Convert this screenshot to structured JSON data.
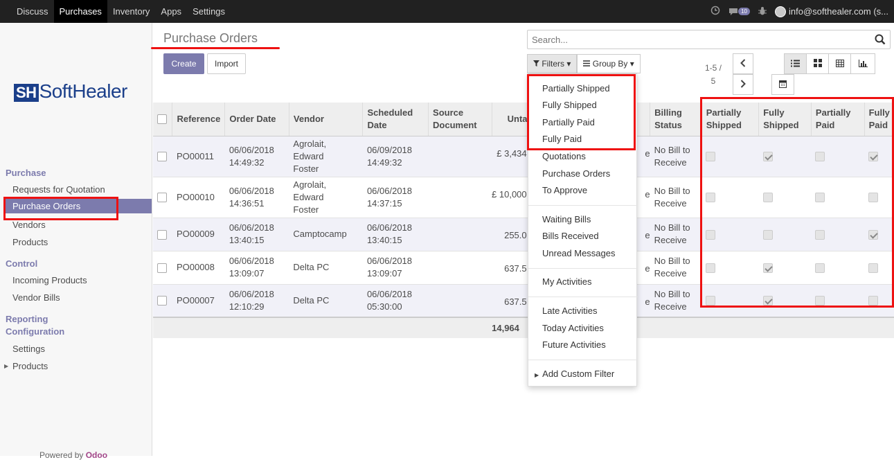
{
  "topnav": [
    "Discuss",
    "Purchases",
    "Inventory",
    "Apps",
    "Settings"
  ],
  "topright": {
    "messages_count": "10",
    "user": "info@softhealer.com (s..."
  },
  "brand": {
    "logo_mark": "SH",
    "logo_text": "SoftHealer"
  },
  "sidebar": {
    "purchase_section": "Purchase",
    "purchase_items": [
      "Requests for Quotation",
      "Purchase Orders",
      "Vendors",
      "Products"
    ],
    "control_section": "Control",
    "control_items": [
      "Incoming Products",
      "Vendor Bills"
    ],
    "reporting_section": "Reporting",
    "configuration_section": "Configuration",
    "configuration_items": [
      "Settings",
      "Products"
    ],
    "powered_prefix": "Powered by",
    "powered_brand": "Odoo"
  },
  "page": {
    "title": "Purchase Orders",
    "create_label": "Create",
    "import_label": "Import"
  },
  "search": {
    "placeholder": "Search..."
  },
  "filters": {
    "filters_label": "Filters",
    "groupby_label": "Group By"
  },
  "pager": {
    "range": "1-5 /",
    "total": "5"
  },
  "dropdown": {
    "custom_filters": [
      "Partially Shipped",
      "Fully Shipped",
      "Partially Paid",
      "Fully Paid"
    ],
    "group1": [
      "Quotations",
      "Purchase Orders",
      "To Approve"
    ],
    "group2": [
      "Waiting Bills",
      "Bills Received",
      "Unread Messages"
    ],
    "group3": [
      "My Activities"
    ],
    "group4": [
      "Late Activities",
      "Today Activities",
      "Future Activities"
    ],
    "add_custom": "Add Custom Filter"
  },
  "table": {
    "headers": {
      "reference": "Reference",
      "order_date": "Order Date",
      "vendor": "Vendor",
      "scheduled_1": "Scheduled",
      "scheduled_2": "Date",
      "source_1": "Source",
      "source_2": "Document",
      "untaxed": "Unta",
      "billing_1": "Billing",
      "billing_2": "Status",
      "partially_shipped_1": "Partially",
      "partially_shipped_2": "Shipped",
      "fully_shipped_1": "Fully",
      "fully_shipped_2": "Shipped",
      "partially_paid_1": "Partially",
      "partially_paid_2": "Paid",
      "fully_paid_1": "Fully",
      "fully_paid_2": "Paid"
    },
    "rows": [
      {
        "ref": "PO00011",
        "date1": "06/06/2018",
        "date2": "14:49:32",
        "vendor1": "Agrolait, Edward",
        "vendor2": "Foster",
        "sched1": "06/09/2018",
        "sched2": "14:49:32",
        "source": "",
        "untaxed": "£ 3,434",
        "hidden_frag": "e",
        "billing1": "No Bill to",
        "billing2": "Receive",
        "partially_shipped": false,
        "fully_shipped": true,
        "partially_paid": false,
        "fully_paid": true
      },
      {
        "ref": "PO00010",
        "date1": "06/06/2018",
        "date2": "14:36:51",
        "vendor1": "Agrolait, Edward",
        "vendor2": "Foster",
        "sched1": "06/06/2018",
        "sched2": "14:37:15",
        "source": "",
        "untaxed": "£ 10,000",
        "hidden_frag": "e",
        "billing1": "No Bill to",
        "billing2": "Receive",
        "partially_shipped": false,
        "fully_shipped": false,
        "partially_paid": false,
        "fully_paid": false
      },
      {
        "ref": "PO00009",
        "date1": "06/06/2018",
        "date2": "13:40:15",
        "vendor1": "Camptocamp",
        "vendor2": "",
        "sched1": "06/06/2018",
        "sched2": "13:40:15",
        "source": "",
        "untaxed": "255.0",
        "hidden_frag": "e",
        "billing1": "No Bill to",
        "billing2": "Receive",
        "partially_shipped": false,
        "fully_shipped": false,
        "partially_paid": false,
        "fully_paid": true
      },
      {
        "ref": "PO00008",
        "date1": "06/06/2018",
        "date2": "13:09:07",
        "vendor1": "Delta PC",
        "vendor2": "",
        "sched1": "06/06/2018",
        "sched2": "13:09:07",
        "source": "",
        "untaxed": "637.5",
        "hidden_frag": "e",
        "billing1": "No Bill to",
        "billing2": "Receive",
        "partially_shipped": false,
        "fully_shipped": true,
        "partially_paid": false,
        "fully_paid": false
      },
      {
        "ref": "PO00007",
        "date1": "06/06/2018",
        "date2": "12:10:29",
        "vendor1": "Delta PC",
        "vendor2": "",
        "sched1": "06/06/2018",
        "sched2": "05:30:00",
        "source": "",
        "untaxed": "637.5",
        "hidden_frag": "e",
        "billing1": "No Bill to",
        "billing2": "Receive",
        "partially_shipped": false,
        "fully_shipped": true,
        "partially_paid": false,
        "fully_paid": false
      }
    ],
    "total": "14,964"
  },
  "colors": {
    "accent": "#7c7bad",
    "highlight": "#ee1111",
    "topbar": "#212121"
  }
}
